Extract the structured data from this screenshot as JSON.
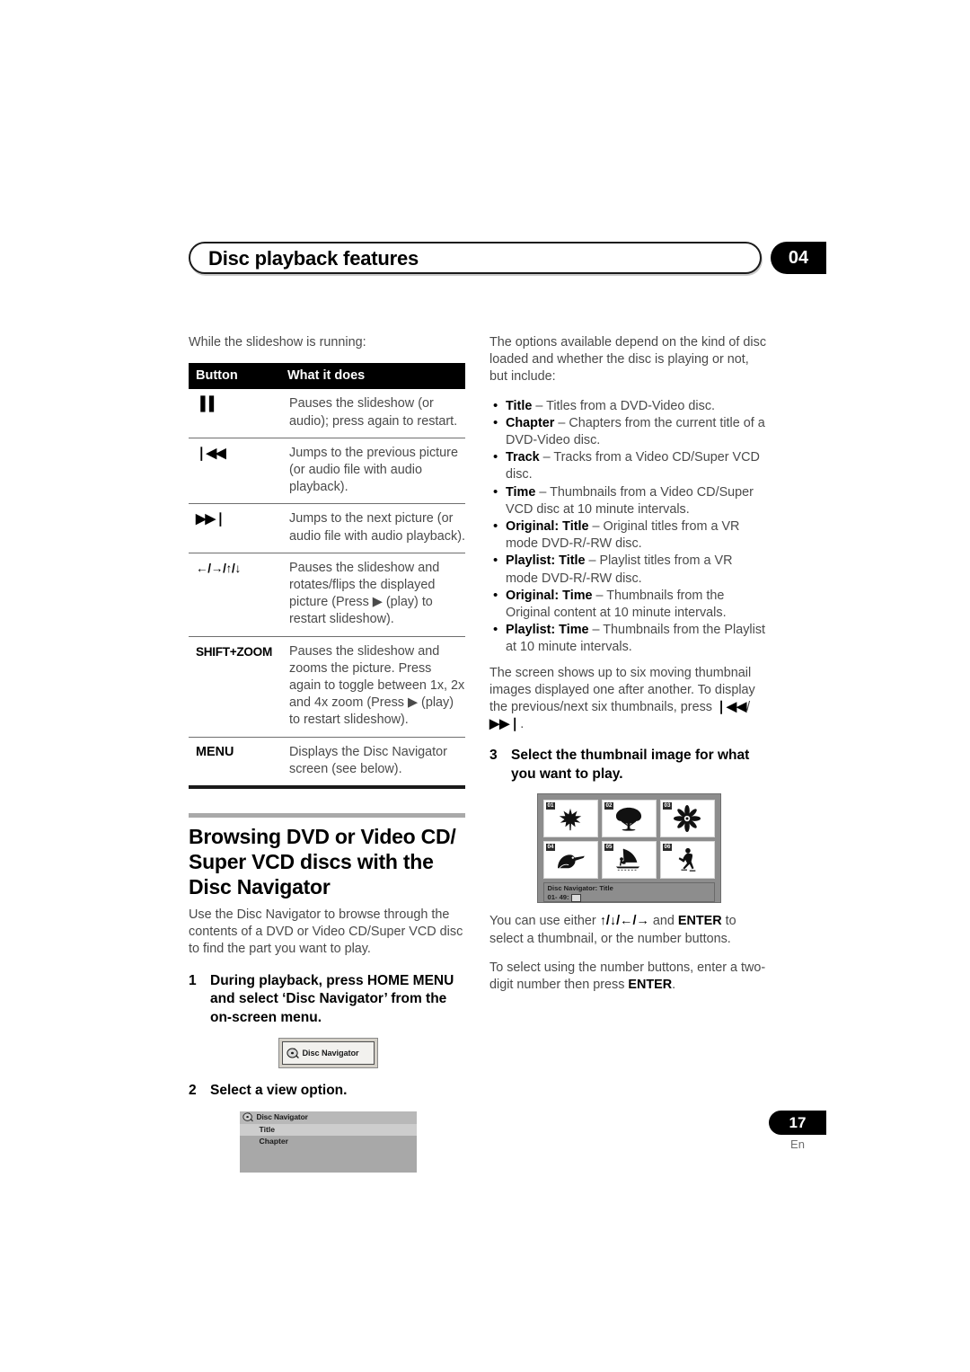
{
  "header": {
    "title": "Disc playback features",
    "chapter": "04"
  },
  "left": {
    "intro": "While the slideshow is running:",
    "table": {
      "columns": [
        "Button",
        "What it does"
      ],
      "rows": [
        {
          "button": "▐▐",
          "button_kind": "pause",
          "desc": "Pauses the slideshow (or audio); press again to restart."
        },
        {
          "button": "❘◀◀",
          "button_kind": "prev",
          "desc": "Jumps to the previous picture (or audio file with audio playback)."
        },
        {
          "button": "▶▶❘",
          "button_kind": "next",
          "desc": "Jumps to the next picture (or audio file with audio playback)."
        },
        {
          "button": "←/→/↑/↓",
          "button_kind": "arrows",
          "desc": "Pauses the slideshow and rotates/flips the displayed picture (Press ▶ (play) to restart slideshow)."
        },
        {
          "button": "SHIFT+ZOOM",
          "button_kind": "text",
          "desc": "Pauses the slideshow and zooms the picture. Press again to toggle between 1x, 2x and 4x zoom (Press ▶ (play) to restart slideshow)."
        },
        {
          "button": "MENU",
          "button_kind": "text",
          "desc": "Displays the Disc Navigator screen (see below)."
        }
      ]
    },
    "section_heading": "Browsing DVD or Video CD/ Super VCD discs with the Disc Navigator",
    "section_body": "Use the Disc Navigator to browse through the contents of a DVD or Video CD/Super VCD disc to find the part you want to play.",
    "step1": {
      "num": "1",
      "text": "During playback, press HOME MENU and select ‘Disc Navigator’ from the on-screen menu."
    },
    "disc_navigator_button": {
      "label": "Disc Navigator",
      "icon": "disc-icon"
    },
    "step2": {
      "num": "2",
      "text": "Select a view option."
    },
    "disc_navigator_menu": {
      "title": "Disc Navigator",
      "items": [
        {
          "label": "Title",
          "selected": true
        },
        {
          "label": "Chapter",
          "selected": false
        }
      ]
    }
  },
  "right": {
    "intro": "The options available depend on the kind of disc loaded and whether the disc is playing or not, but include:",
    "bullets": [
      {
        "term": "Title",
        "dash": " – ",
        "desc": "Titles from a DVD-Video disc."
      },
      {
        "term": "Chapter",
        "dash": " – ",
        "desc": "Chapters from the current title of a DVD-Video disc."
      },
      {
        "term": "Track",
        "dash": " – ",
        "desc": "Tracks from a Video CD/Super VCD disc."
      },
      {
        "term": "Time",
        "dash": " – ",
        "desc": "Thumbnails from a Video CD/Super VCD disc at 10 minute intervals."
      },
      {
        "term": "Original: Title",
        "dash": " – ",
        "desc": "Original titles from a VR mode DVD-R/-RW disc."
      },
      {
        "term": "Playlist: Title",
        "dash": " – ",
        "desc": "Playlist titles from a VR mode DVD-R/-RW disc."
      },
      {
        "term": "Original: Time",
        "dash": " – ",
        "desc": "Thumbnails from the Original content at 10 minute intervals."
      },
      {
        "term": "Playlist: Time",
        "dash": " – ",
        "desc": "Thumbnails from the Playlist at 10 minute intervals."
      }
    ],
    "para_six_thumbs_a": "The screen shows up to six moving thumbnail images displayed one after another. To display the previous/next six thumbnails, press ",
    "para_six_thumbs_prev": "❘◀◀",
    "para_six_thumbs_slash": "/",
    "para_six_thumbs_next": "▶▶❘",
    "para_six_thumbs_end": ".",
    "step3": {
      "num": "3",
      "text": "Select the thumbnail image for what you want to play."
    },
    "thumbnail_screen": {
      "thumbs": [
        {
          "num": "01",
          "icon": "maple-leaf-icon"
        },
        {
          "num": "02",
          "icon": "tree-icon"
        },
        {
          "num": "03",
          "icon": "flower-icon"
        },
        {
          "num": "04",
          "icon": "toucan-icon"
        },
        {
          "num": "05",
          "icon": "windsurfer-icon"
        },
        {
          "num": "06",
          "icon": "skater-icon"
        }
      ],
      "status_line1": "Disc Navigator: Title",
      "status_line2": "01- 49:"
    },
    "para_use_either_a": "You can use either ",
    "para_use_either_arrows": "↑/↓/←/→",
    "para_use_either_b": " and ",
    "para_use_either_enter": "ENTER",
    "para_use_either_c": " to select a thumbnail, or the number buttons.",
    "para_numbers_a": "To select using the number buttons, enter a two-digit number then press ",
    "para_numbers_enter": "ENTER",
    "para_numbers_b": "."
  },
  "footer": {
    "page": "17",
    "language": "En"
  }
}
